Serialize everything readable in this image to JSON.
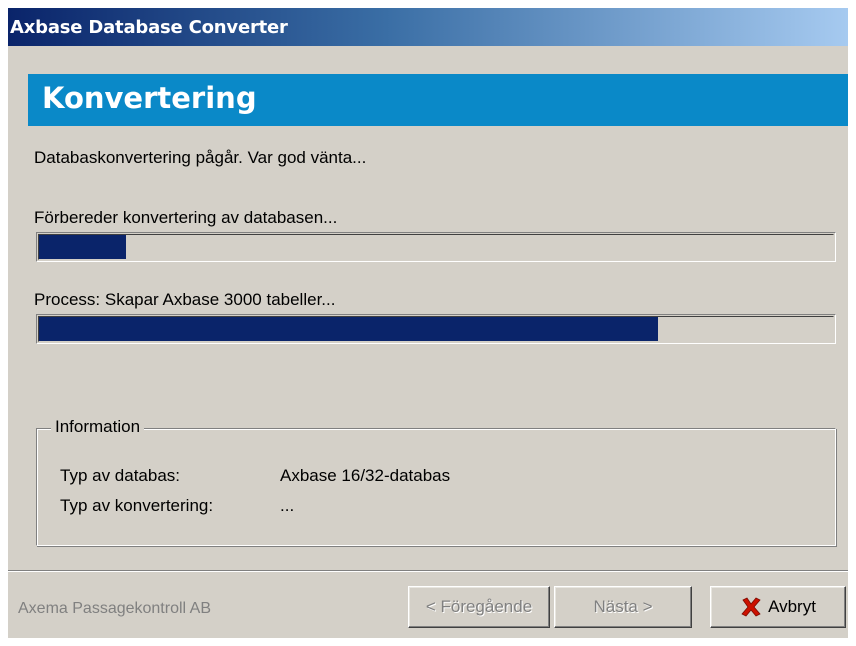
{
  "window": {
    "title": "Axbase Database Converter"
  },
  "header": {
    "title": "Konvertering"
  },
  "main": {
    "status_text": "Databaskonvertering pågår. Var god vänta...",
    "step1": {
      "label": "Förbereder konvertering av databasen...",
      "progress_percent": 11
    },
    "step2": {
      "label": "Process: Skapar Axbase 3000 tabeller...",
      "progress_percent": 78
    }
  },
  "info": {
    "legend": "Information",
    "rows": [
      {
        "key": "Typ av databas:",
        "value": "Axbase 16/32-databas"
      },
      {
        "key": "Typ av konvertering:",
        "value": "..."
      }
    ]
  },
  "footer": {
    "company": "Axema Passagekontroll AB",
    "back_label": "< Föregående",
    "next_label": "Nästa >",
    "cancel_label": "Avbryt"
  },
  "colors": {
    "titlebar_start": "#0a246a",
    "header_band": "#0a89c8",
    "progress_fill": "#0a246a",
    "cancel_icon": "#cc1100"
  },
  "icons": {
    "cancel": "red-x-icon"
  }
}
